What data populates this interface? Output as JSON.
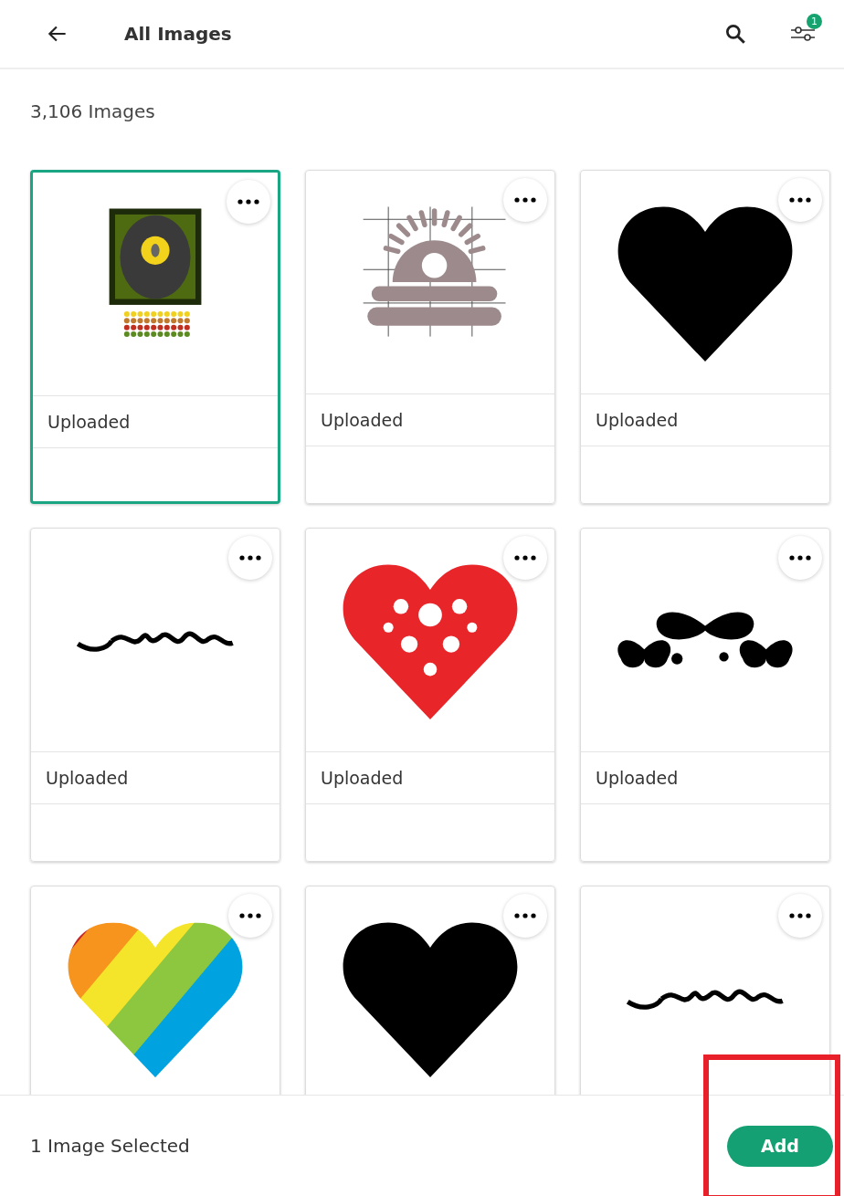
{
  "header": {
    "title": "All Images",
    "filter_badge": "1"
  },
  "count": "3,106 Images",
  "images": [
    {
      "kind": "owl-panel",
      "label": "Uploaded",
      "selected": true
    },
    {
      "kind": "sun-emblem",
      "label": "Uploaded",
      "selected": false
    },
    {
      "kind": "heart",
      "label": "Uploaded",
      "selected": false
    },
    {
      "kind": "script-word",
      "label": "Uploaded",
      "selected": false
    },
    {
      "kind": "floral-heart",
      "label": "Uploaded",
      "selected": false
    },
    {
      "kind": "butterflies",
      "label": "Uploaded",
      "selected": false
    },
    {
      "kind": "rainbow-heart",
      "selected": false
    },
    {
      "kind": "heart",
      "selected": false
    },
    {
      "kind": "script-word",
      "selected": false
    }
  ],
  "footer": {
    "status": "1 Image Selected",
    "button": "Add",
    "highlighted": true
  }
}
